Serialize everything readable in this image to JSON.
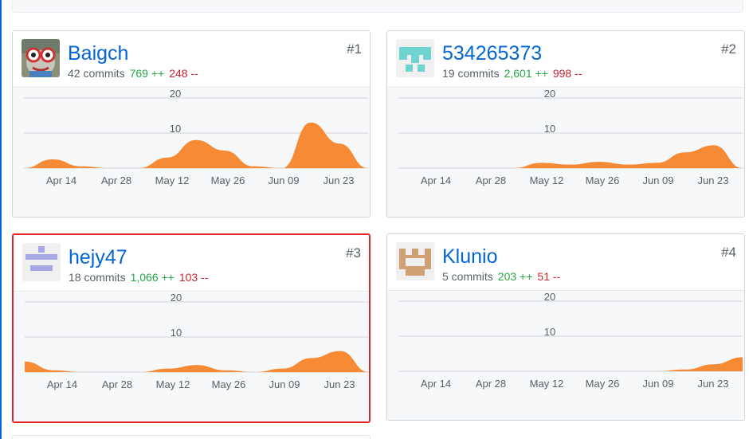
{
  "colors": {
    "area": "#f68a35",
    "link": "#0366d6",
    "add": "#28a745",
    "del": "#cb2431",
    "highlight": "#e0252c"
  },
  "x_labels": [
    "Apr 14",
    "Apr 28",
    "May 12",
    "May 26",
    "Jun 09",
    "Jun 23"
  ],
  "y_ticks": [
    10,
    20
  ],
  "contributors": [
    {
      "name": "Baigch",
      "rank": "#1",
      "commits": "42 commits",
      "additions": "769 ++",
      "deletions": "248 --",
      "avatar_icon": "frog-avatar-icon",
      "highlighted": false,
      "chart_data": {
        "type": "area",
        "x": [
          "Apr 07",
          "Apr 14",
          "Apr 21",
          "Apr 28",
          "May 05",
          "May 12",
          "May 19",
          "May 26",
          "Jun 02",
          "Jun 09",
          "Jun 16",
          "Jun 23",
          "Jun 30"
        ],
        "values": [
          0,
          2.5,
          0.5,
          0,
          0,
          3,
          8,
          5,
          0.5,
          0,
          13,
          7,
          0
        ],
        "ylim": [
          0,
          20
        ]
      }
    },
    {
      "name": "534265373",
      "rank": "#2",
      "commits": "19 commits",
      "additions": "2,601 ++",
      "deletions": "998 --",
      "avatar_icon": "identicon-teal-icon",
      "highlighted": false,
      "chart_data": {
        "type": "area",
        "x": [
          "Apr 07",
          "Apr 14",
          "Apr 21",
          "Apr 28",
          "May 05",
          "May 12",
          "May 19",
          "May 26",
          "Jun 02",
          "Jun 09",
          "Jun 16",
          "Jun 23",
          "Jun 30"
        ],
        "values": [
          0,
          0,
          0,
          0,
          0,
          1.5,
          1,
          1.8,
          1,
          1.5,
          4.5,
          6.5,
          0
        ],
        "ylim": [
          0,
          20
        ]
      }
    },
    {
      "name": "hejy47",
      "rank": "#3",
      "commits": "18 commits",
      "additions": "1,066 ++",
      "deletions": "103 --",
      "avatar_icon": "identicon-lavender-icon",
      "highlighted": true,
      "chart_data": {
        "type": "area",
        "x": [
          "Apr 07",
          "Apr 14",
          "Apr 21",
          "Apr 28",
          "May 05",
          "May 12",
          "May 19",
          "May 26",
          "Jun 02",
          "Jun 09",
          "Jun 16",
          "Jun 23",
          "Jun 30"
        ],
        "values": [
          3,
          0.5,
          0,
          0,
          0,
          1,
          2,
          0.5,
          0,
          1,
          4,
          6,
          0
        ],
        "ylim": [
          0,
          20
        ]
      }
    },
    {
      "name": "Klunio",
      "rank": "#4",
      "commits": "5 commits",
      "additions": "203 ++",
      "deletions": "51 --",
      "avatar_icon": "identicon-tan-icon",
      "highlighted": false,
      "chart_data": {
        "type": "area",
        "x": [
          "Apr 07",
          "Apr 14",
          "Apr 21",
          "Apr 28",
          "May 05",
          "May 12",
          "May 19",
          "May 26",
          "Jun 02",
          "Jun 09",
          "Jun 16",
          "Jun 23",
          "Jun 30"
        ],
        "values": [
          0,
          0,
          0,
          0,
          0,
          0,
          0,
          0,
          0,
          0,
          0.5,
          2,
          4
        ],
        "ylim": [
          0,
          20
        ]
      }
    }
  ]
}
